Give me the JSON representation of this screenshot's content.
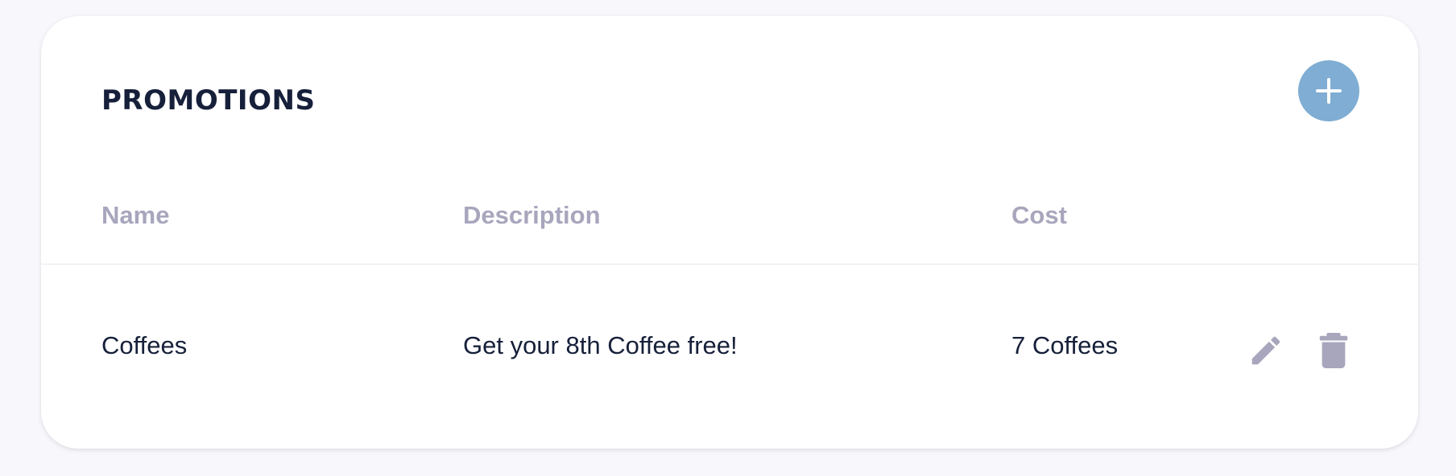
{
  "card": {
    "title": "PROMOTIONS",
    "add_icon": "plus-icon"
  },
  "table": {
    "columns": [
      "Name",
      "Description",
      "Cost"
    ],
    "rows": [
      {
        "name": "Coffees",
        "description": "Get your 8th Coffee free!",
        "cost": "7 Coffees",
        "actions": [
          "pencil-icon",
          "trash-icon"
        ]
      }
    ]
  },
  "colors": {
    "accent": "#7fadd3",
    "title_text": "#17203a",
    "header_text": "#a8a6bd",
    "icon_muted": "#a8a6bd",
    "page_background": "#f8f8fc",
    "card_background": "#ffffff"
  }
}
